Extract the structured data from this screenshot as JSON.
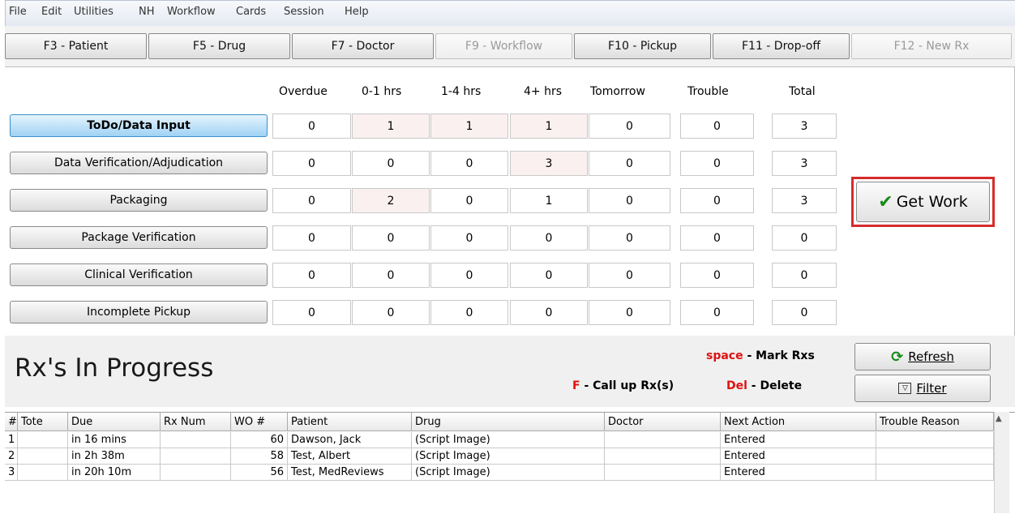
{
  "menu": [
    "File",
    "Edit",
    "Utilities",
    "NH",
    "Workflow",
    "Cards",
    "Session",
    "Help"
  ],
  "fkeys": [
    {
      "label": "F3 - Patient",
      "enabled": true
    },
    {
      "label": "F5 - Drug",
      "enabled": true
    },
    {
      "label": "F7 - Doctor",
      "enabled": true
    },
    {
      "label": "F9 - Workflow",
      "enabled": false
    },
    {
      "label": "F10 - Pickup",
      "enabled": true
    },
    {
      "label": "F11 - Drop-off",
      "enabled": true
    },
    {
      "label": "F12 - New Rx",
      "enabled": false
    }
  ],
  "queue_columns": [
    "Overdue",
    "0-1 hrs",
    "1-4 hrs",
    "4+ hrs",
    "Tomorrow",
    "Trouble",
    "Total"
  ],
  "queues": [
    {
      "label": "ToDo/Data Input",
      "values": [
        "0",
        "1",
        "1",
        "1",
        "0",
        "0",
        "3"
      ]
    },
    {
      "label": "Data Verification/Adjudication",
      "values": [
        "0",
        "0",
        "0",
        "3",
        "0",
        "0",
        "3"
      ]
    },
    {
      "label": "Packaging",
      "values": [
        "0",
        "2",
        "0",
        "1",
        "0",
        "0",
        "3"
      ]
    },
    {
      "label": "Package Verification",
      "values": [
        "0",
        "0",
        "0",
        "0",
        "0",
        "0",
        "0"
      ]
    },
    {
      "label": "Clinical Verification",
      "values": [
        "0",
        "0",
        "0",
        "0",
        "0",
        "0",
        "0"
      ]
    },
    {
      "label": "Incomplete Pickup",
      "values": [
        "0",
        "0",
        "0",
        "0",
        "0",
        "0",
        "0"
      ]
    }
  ],
  "get_work_label": "Get Work",
  "in_progress_title": "Rx's In Progress",
  "hints": {
    "space_key": "space",
    "space_text": " - Mark Rxs",
    "f_key": "F",
    "f_text": " - Call up Rx(s)",
    "del_key": "Del",
    "del_text": " - Delete"
  },
  "refresh_label": "Refresh",
  "filter_label": "Filter",
  "grid_columns": [
    "#",
    "Tote",
    "Due",
    "Rx Num",
    "WO #",
    "Patient",
    "Drug",
    "Doctor",
    "Next Action",
    "Trouble Reason"
  ],
  "grid_rows": [
    [
      "1",
      "",
      "in 16 mins",
      "",
      "60",
      "Dawson, Jack",
      "(Script Image)",
      "",
      "Entered",
      ""
    ],
    [
      "2",
      "",
      "in 2h 38m",
      "",
      "58",
      "Test, Albert",
      "(Script Image)",
      "",
      "Entered",
      ""
    ],
    [
      "3",
      "",
      "in 20h 10m",
      "",
      "56",
      "Test, MedReviews",
      "(Script Image)",
      "",
      "Entered",
      ""
    ]
  ]
}
